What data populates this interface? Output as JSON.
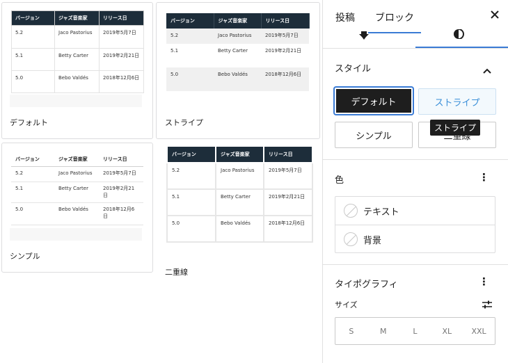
{
  "table": {
    "headers": [
      "バージョン",
      "ジャズ音楽家",
      "リリース日"
    ],
    "rows": [
      [
        "5.2",
        "Jaco Pastorius",
        "2019年5月7日"
      ],
      [
        "5.1",
        "Betty Carter",
        "2019年2月21日"
      ],
      [
        "5.0",
        "Bebo Valdés",
        "2018年12月6日"
      ]
    ]
  },
  "styles": {
    "default_caption": "デフォルト",
    "stripe_caption": "ストライプ",
    "simple_caption": "シンプル",
    "double_caption": "二重線"
  },
  "sidebar": {
    "tabs": {
      "post": "投稿",
      "block": "ブロック"
    },
    "close_icon": "close-icon",
    "style_section": {
      "title": "スタイル",
      "buttons": {
        "default": "デフォルト",
        "stripe": "ストライプ",
        "simple": "シンプル",
        "double_partial": "二重線"
      },
      "tooltip": "ストライプ"
    },
    "color_section": {
      "title": "色",
      "text": "テキスト",
      "background": "背景"
    },
    "typography_section": {
      "title": "タイポグラフィ",
      "size_label": "サイズ",
      "sizes": [
        "S",
        "M",
        "L",
        "XL",
        "XXL"
      ]
    }
  },
  "colors": {
    "accent": "#3a7bd5",
    "header_dark": "#1d2d3a",
    "active_btn": "#1e1e1e"
  }
}
